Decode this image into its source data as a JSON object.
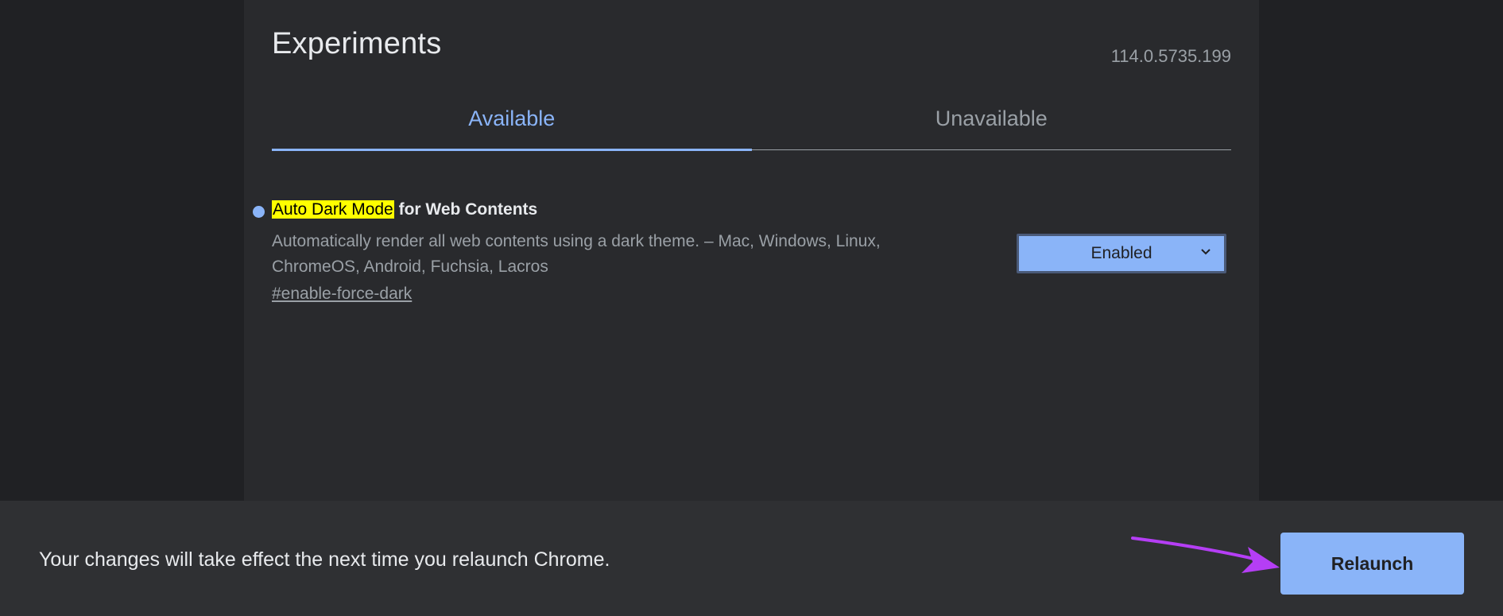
{
  "header": {
    "title": "Experiments",
    "version": "114.0.5735.199"
  },
  "tabs": [
    {
      "label": "Available",
      "active": true
    },
    {
      "label": "Unavailable",
      "active": false
    }
  ],
  "experiment": {
    "title_highlight": "Auto Dark Mode",
    "title_rest": " for Web Contents",
    "description": "Automatically render all web contents using a dark theme. – Mac, Windows, Linux, ChromeOS, Android, Fuchsia, Lacros",
    "link": "#enable-force-dark",
    "selected_option": "Enabled"
  },
  "bottom_bar": {
    "message": "Your changes will take effect the next time you relaunch Chrome.",
    "relaunch_label": "Relaunch"
  },
  "colors": {
    "accent": "#8ab4f8",
    "highlight": "#ffff00",
    "annotation_arrow": "#b53ef5"
  },
  "icons": {
    "modified_indicator": "dot-icon",
    "select_arrow": "chevron-down-icon",
    "annotation": "arrow-icon"
  }
}
